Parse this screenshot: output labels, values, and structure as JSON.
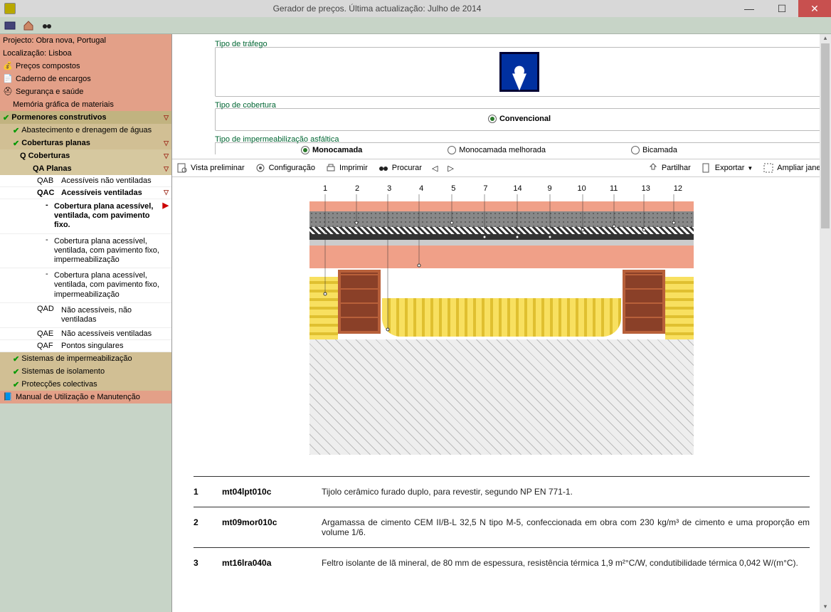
{
  "window": {
    "title": "Gerador de preços. Última actualização: Julho de 2014"
  },
  "sidebar": {
    "project": "Projecto: Obra nova, Portugal",
    "location": "Localização: Lisboa",
    "items": [
      {
        "label": "Preços compostos"
      },
      {
        "label": "Caderno de encargos"
      },
      {
        "label": "Segurança e saúde"
      },
      {
        "label": "Memória gráfica de materiais"
      }
    ],
    "section1": "Pormenores construtivos",
    "sub1a": "Abastecimento e drenagem de águas",
    "sub1b": "Coberturas planas",
    "q_label": "Q  Coberturas",
    "qa_label": "QA  Planas",
    "qab": {
      "code": "QAB",
      "label": "Acessíveis não ventiladas"
    },
    "qac": {
      "code": "QAC",
      "label": "Acessíveis ventiladas"
    },
    "qac_items": [
      "Cobertura plana acessível, ventilada, com pavimento fixo.",
      "Cobertura plana acessível, ventilada, com pavimento fixo, impermeabilização",
      "Cobertura plana acessível, ventilada, com pavimento fixo, impermeabilização"
    ],
    "qad": {
      "code": "QAD",
      "label": "Não acessíveis, não ventiladas"
    },
    "qae": {
      "code": "QAE",
      "label": "Não acessíveis ventiladas"
    },
    "qaf": {
      "code": "QAF",
      "label": "Pontos singulares"
    },
    "bottom": [
      "Sistemas de impermeabilização",
      "Sistemas de isolamento",
      "Protecções colectivas"
    ],
    "manual": "Manual de Utilização e Manutenção"
  },
  "config": {
    "trafego_label": "Tipo de tráfego",
    "cobertura_label": "Tipo de cobertura",
    "cobertura_options": [
      "Convencional"
    ],
    "impermeab_label": "Tipo de impermeabilização asfáltica",
    "impermeab_options": [
      "Monocamada",
      "Monocamada melhorada",
      "Bicamada"
    ]
  },
  "toolbar": {
    "preview": "Vista preliminar",
    "config": "Configuração",
    "print": "Imprimir",
    "search": "Procurar",
    "share": "Partilhar",
    "export": "Exportar",
    "expand": "Ampliar janela"
  },
  "diagram": {
    "numbers": [
      "1",
      "2",
      "3",
      "4",
      "5",
      "7",
      "14",
      "9",
      "10",
      "11",
      "13",
      "12"
    ]
  },
  "legend": [
    {
      "num": "1",
      "code": "mt04lpt010c",
      "desc": "Tijolo cerâmico furado duplo, para revestir, segundo NP EN 771-1."
    },
    {
      "num": "2",
      "code": "mt09mor010c",
      "desc": "Argamassa de cimento CEM II/B-L 32,5 N tipo M-5, confeccionada em obra com 230 kg/m³ de cimento e uma proporção em volume 1/6."
    },
    {
      "num": "3",
      "code": "mt16lra040a",
      "desc": "Feltro isolante de lã mineral, de 80 mm de espessura, resistência térmica 1,9 m²°C/W, condutibilidade térmica 0,042 W/(m°C)."
    }
  ]
}
